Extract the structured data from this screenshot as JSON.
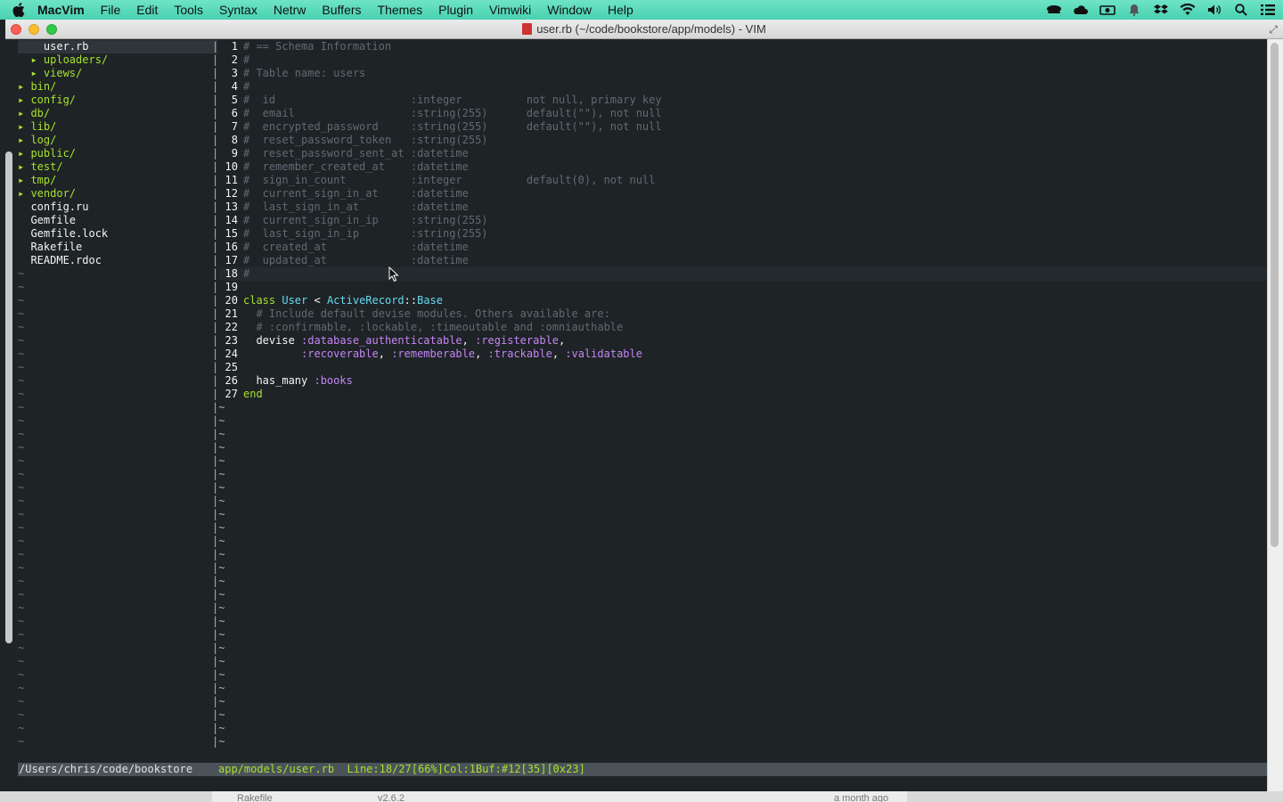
{
  "menubar": {
    "app_name": "MacVim",
    "items": [
      "File",
      "Edit",
      "Tools",
      "Syntax",
      "Netrw",
      "Buffers",
      "Themes",
      "Plugin",
      "Vimwiki",
      "Window",
      "Help"
    ],
    "status_icons": [
      "glasses-icon",
      "cloud-icon",
      "camera-icon",
      "bell-icon",
      "dropbox-icon",
      "wifi-icon",
      "volume-icon",
      "spotlight-icon",
      "list-icon"
    ]
  },
  "window": {
    "title": "user.rb (~/code/bookstore/app/models) - VIM"
  },
  "nerdtree": {
    "lines": [
      {
        "text": "    user.rb",
        "kind": "current"
      },
      {
        "text": "  ▸ uploaders/",
        "kind": "dir"
      },
      {
        "text": "  ▸ views/",
        "kind": "dir"
      },
      {
        "text": "▸ bin/",
        "kind": "dir"
      },
      {
        "text": "▸ config/",
        "kind": "dir"
      },
      {
        "text": "▸ db/",
        "kind": "dir"
      },
      {
        "text": "▸ lib/",
        "kind": "dir"
      },
      {
        "text": "▸ log/",
        "kind": "dir"
      },
      {
        "text": "▸ public/",
        "kind": "dir"
      },
      {
        "text": "▸ test/",
        "kind": "dir"
      },
      {
        "text": "▸ tmp/",
        "kind": "dir"
      },
      {
        "text": "▸ vendor/",
        "kind": "dir"
      },
      {
        "text": "  config.ru",
        "kind": "file"
      },
      {
        "text": "  Gemfile",
        "kind": "file"
      },
      {
        "text": "  Gemfile.lock",
        "kind": "file"
      },
      {
        "text": "  Rakefile",
        "kind": "file"
      },
      {
        "text": "  README.rdoc",
        "kind": "file"
      }
    ],
    "tilde_rows": 36
  },
  "editor": {
    "lines": [
      {
        "n": "1",
        "segs": [
          [
            "cmt",
            "# == Schema Information"
          ]
        ]
      },
      {
        "n": "2",
        "segs": [
          [
            "cmt",
            "#"
          ]
        ]
      },
      {
        "n": "3",
        "segs": [
          [
            "cmt",
            "# Table name: users"
          ]
        ]
      },
      {
        "n": "4",
        "segs": [
          [
            "cmt",
            "#"
          ]
        ]
      },
      {
        "n": "5",
        "segs": [
          [
            "cmt",
            "#  id                     :integer          not null, primary key"
          ]
        ]
      },
      {
        "n": "6",
        "segs": [
          [
            "cmt",
            "#  email                  :string(255)      default(\"\"), not null"
          ]
        ]
      },
      {
        "n": "7",
        "segs": [
          [
            "cmt",
            "#  encrypted_password     :string(255)      default(\"\"), not null"
          ]
        ]
      },
      {
        "n": "8",
        "segs": [
          [
            "cmt",
            "#  reset_password_token   :string(255)"
          ]
        ]
      },
      {
        "n": "9",
        "segs": [
          [
            "cmt",
            "#  reset_password_sent_at :datetime"
          ]
        ]
      },
      {
        "n": "10",
        "segs": [
          [
            "cmt",
            "#  remember_created_at    :datetime"
          ]
        ]
      },
      {
        "n": "11",
        "segs": [
          [
            "cmt",
            "#  sign_in_count          :integer          default(0), not null"
          ]
        ]
      },
      {
        "n": "12",
        "segs": [
          [
            "cmt",
            "#  current_sign_in_at     :datetime"
          ]
        ]
      },
      {
        "n": "13",
        "segs": [
          [
            "cmt",
            "#  last_sign_in_at        :datetime"
          ]
        ]
      },
      {
        "n": "14",
        "segs": [
          [
            "cmt",
            "#  current_sign_in_ip     :string(255)"
          ]
        ]
      },
      {
        "n": "15",
        "segs": [
          [
            "cmt",
            "#  last_sign_in_ip        :string(255)"
          ]
        ]
      },
      {
        "n": "16",
        "segs": [
          [
            "cmt",
            "#  created_at             :datetime"
          ]
        ]
      },
      {
        "n": "17",
        "segs": [
          [
            "cmt",
            "#  updated_at             :datetime"
          ]
        ]
      },
      {
        "n": "18",
        "segs": [
          [
            "cmt",
            "#"
          ]
        ]
      },
      {
        "n": "19",
        "segs": []
      },
      {
        "n": "20",
        "segs": [
          [
            "kw",
            "class "
          ],
          [
            "cls",
            "User"
          ],
          [
            "plain",
            " < "
          ],
          [
            "cls",
            "ActiveRecord"
          ],
          [
            "plain",
            "::"
          ],
          [
            "cls",
            "Base"
          ]
        ]
      },
      {
        "n": "21",
        "segs": [
          [
            "cmt",
            "  # Include default devise modules. Others available are:"
          ]
        ]
      },
      {
        "n": "22",
        "segs": [
          [
            "cmt",
            "  # :confirmable, :lockable, :timeoutable and :omniauthable"
          ]
        ]
      },
      {
        "n": "23",
        "segs": [
          [
            "plain",
            "  devise "
          ],
          [
            "sym",
            ":database_authenticatable"
          ],
          [
            "plain",
            ", "
          ],
          [
            "sym",
            ":registerable"
          ],
          [
            "plain",
            ","
          ]
        ]
      },
      {
        "n": "24",
        "segs": [
          [
            "plain",
            "         "
          ],
          [
            "sym",
            ":recoverable"
          ],
          [
            "plain",
            ", "
          ],
          [
            "sym",
            ":rememberable"
          ],
          [
            "plain",
            ", "
          ],
          [
            "sym",
            ":trackable"
          ],
          [
            "plain",
            ", "
          ],
          [
            "sym",
            ":validatable"
          ]
        ]
      },
      {
        "n": "25",
        "segs": []
      },
      {
        "n": "26",
        "segs": [
          [
            "plain",
            "  has_many "
          ],
          [
            "sym",
            ":books"
          ]
        ]
      },
      {
        "n": "27",
        "segs": [
          [
            "kw",
            "end"
          ]
        ]
      }
    ],
    "cursor_line": "18",
    "tilde_rows": 27
  },
  "statusline": {
    "left": "/Users/chris/code/bookstore",
    "right": "app/models/user.rb  Line:18/27[66%]Col:1Buf:#12[35][0x23]"
  },
  "bottom_strip": {
    "items": [
      "Rakefile",
      "v2.6.2",
      "a month ago"
    ]
  }
}
